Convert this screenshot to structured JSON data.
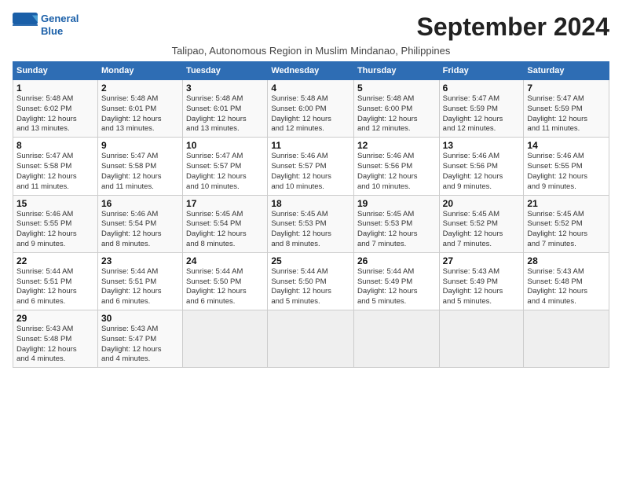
{
  "logo": {
    "line1": "General",
    "line2": "Blue"
  },
  "title": "September 2024",
  "subtitle": "Talipao, Autonomous Region in Muslim Mindanao, Philippines",
  "weekdays": [
    "Sunday",
    "Monday",
    "Tuesday",
    "Wednesday",
    "Thursday",
    "Friday",
    "Saturday"
  ],
  "weeks": [
    [
      {
        "day": "1",
        "info": "Sunrise: 5:48 AM\nSunset: 6:02 PM\nDaylight: 12 hours\nand 13 minutes."
      },
      {
        "day": "2",
        "info": "Sunrise: 5:48 AM\nSunset: 6:01 PM\nDaylight: 12 hours\nand 13 minutes."
      },
      {
        "day": "3",
        "info": "Sunrise: 5:48 AM\nSunset: 6:01 PM\nDaylight: 12 hours\nand 13 minutes."
      },
      {
        "day": "4",
        "info": "Sunrise: 5:48 AM\nSunset: 6:00 PM\nDaylight: 12 hours\nand 12 minutes."
      },
      {
        "day": "5",
        "info": "Sunrise: 5:48 AM\nSunset: 6:00 PM\nDaylight: 12 hours\nand 12 minutes."
      },
      {
        "day": "6",
        "info": "Sunrise: 5:47 AM\nSunset: 5:59 PM\nDaylight: 12 hours\nand 12 minutes."
      },
      {
        "day": "7",
        "info": "Sunrise: 5:47 AM\nSunset: 5:59 PM\nDaylight: 12 hours\nand 11 minutes."
      }
    ],
    [
      {
        "day": "8",
        "info": "Sunrise: 5:47 AM\nSunset: 5:58 PM\nDaylight: 12 hours\nand 11 minutes."
      },
      {
        "day": "9",
        "info": "Sunrise: 5:47 AM\nSunset: 5:58 PM\nDaylight: 12 hours\nand 11 minutes."
      },
      {
        "day": "10",
        "info": "Sunrise: 5:47 AM\nSunset: 5:57 PM\nDaylight: 12 hours\nand 10 minutes."
      },
      {
        "day": "11",
        "info": "Sunrise: 5:46 AM\nSunset: 5:57 PM\nDaylight: 12 hours\nand 10 minutes."
      },
      {
        "day": "12",
        "info": "Sunrise: 5:46 AM\nSunset: 5:56 PM\nDaylight: 12 hours\nand 10 minutes."
      },
      {
        "day": "13",
        "info": "Sunrise: 5:46 AM\nSunset: 5:56 PM\nDaylight: 12 hours\nand 9 minutes."
      },
      {
        "day": "14",
        "info": "Sunrise: 5:46 AM\nSunset: 5:55 PM\nDaylight: 12 hours\nand 9 minutes."
      }
    ],
    [
      {
        "day": "15",
        "info": "Sunrise: 5:46 AM\nSunset: 5:55 PM\nDaylight: 12 hours\nand 9 minutes."
      },
      {
        "day": "16",
        "info": "Sunrise: 5:46 AM\nSunset: 5:54 PM\nDaylight: 12 hours\nand 8 minutes."
      },
      {
        "day": "17",
        "info": "Sunrise: 5:45 AM\nSunset: 5:54 PM\nDaylight: 12 hours\nand 8 minutes."
      },
      {
        "day": "18",
        "info": "Sunrise: 5:45 AM\nSunset: 5:53 PM\nDaylight: 12 hours\nand 8 minutes."
      },
      {
        "day": "19",
        "info": "Sunrise: 5:45 AM\nSunset: 5:53 PM\nDaylight: 12 hours\nand 7 minutes."
      },
      {
        "day": "20",
        "info": "Sunrise: 5:45 AM\nSunset: 5:52 PM\nDaylight: 12 hours\nand 7 minutes."
      },
      {
        "day": "21",
        "info": "Sunrise: 5:45 AM\nSunset: 5:52 PM\nDaylight: 12 hours\nand 7 minutes."
      }
    ],
    [
      {
        "day": "22",
        "info": "Sunrise: 5:44 AM\nSunset: 5:51 PM\nDaylight: 12 hours\nand 6 minutes."
      },
      {
        "day": "23",
        "info": "Sunrise: 5:44 AM\nSunset: 5:51 PM\nDaylight: 12 hours\nand 6 minutes."
      },
      {
        "day": "24",
        "info": "Sunrise: 5:44 AM\nSunset: 5:50 PM\nDaylight: 12 hours\nand 6 minutes."
      },
      {
        "day": "25",
        "info": "Sunrise: 5:44 AM\nSunset: 5:50 PM\nDaylight: 12 hours\nand 5 minutes."
      },
      {
        "day": "26",
        "info": "Sunrise: 5:44 AM\nSunset: 5:49 PM\nDaylight: 12 hours\nand 5 minutes."
      },
      {
        "day": "27",
        "info": "Sunrise: 5:43 AM\nSunset: 5:49 PM\nDaylight: 12 hours\nand 5 minutes."
      },
      {
        "day": "28",
        "info": "Sunrise: 5:43 AM\nSunset: 5:48 PM\nDaylight: 12 hours\nand 4 minutes."
      }
    ],
    [
      {
        "day": "29",
        "info": "Sunrise: 5:43 AM\nSunset: 5:48 PM\nDaylight: 12 hours\nand 4 minutes."
      },
      {
        "day": "30",
        "info": "Sunrise: 5:43 AM\nSunset: 5:47 PM\nDaylight: 12 hours\nand 4 minutes."
      },
      {
        "day": "",
        "info": ""
      },
      {
        "day": "",
        "info": ""
      },
      {
        "day": "",
        "info": ""
      },
      {
        "day": "",
        "info": ""
      },
      {
        "day": "",
        "info": ""
      }
    ]
  ]
}
